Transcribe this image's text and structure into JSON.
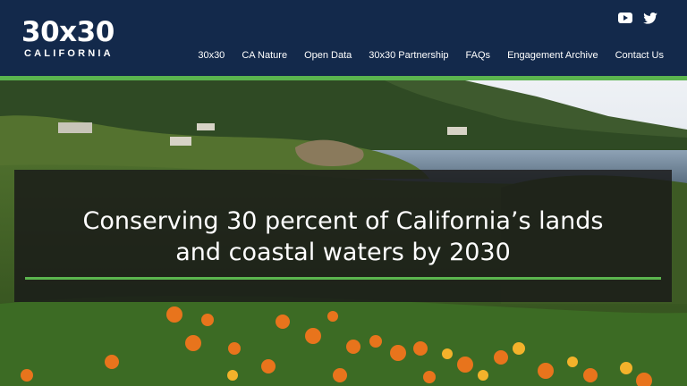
{
  "brand": {
    "logo_main": "30x30",
    "logo_sub": "CALIFORNIA"
  },
  "social": [
    {
      "icon": "youtube-icon"
    },
    {
      "icon": "twitter-icon"
    }
  ],
  "nav": {
    "items": [
      {
        "label": "30x30"
      },
      {
        "label": "CA Nature"
      },
      {
        "label": "Open Data"
      },
      {
        "label": "30x30 Partnership"
      },
      {
        "label": "FAQs"
      },
      {
        "label": "Engagement Archive"
      },
      {
        "label": "Contact Us"
      }
    ]
  },
  "hero": {
    "headline_line1": "Conserving 30 percent of California’s lands",
    "headline_line2": "and coastal waters by 2030"
  },
  "colors": {
    "header_bg": "#13294b",
    "accent_green": "#5bb54e",
    "poppy_orange": "#e8741c"
  }
}
